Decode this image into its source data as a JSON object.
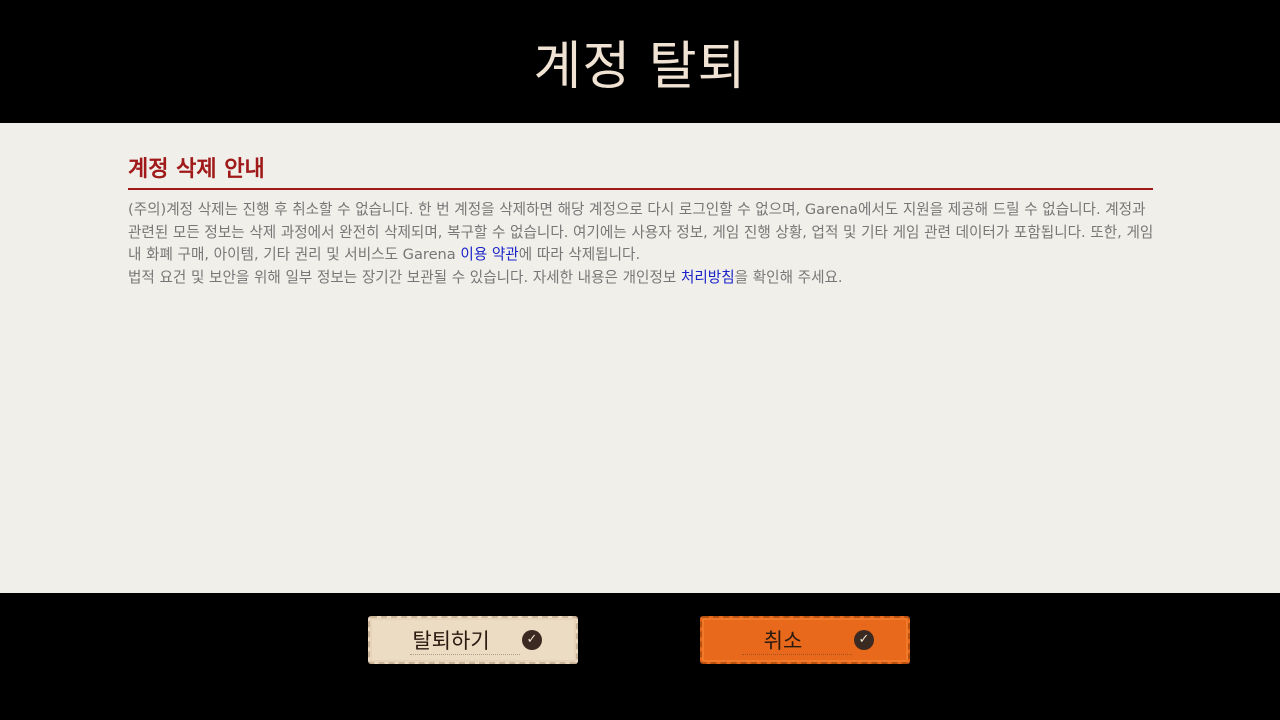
{
  "header": {
    "title": "계정 탈퇴"
  },
  "notice": {
    "title": "계정 삭제 안내",
    "para1_a": "(주의)계정 삭제는 진행 후 취소할 수 없습니다. 한 번 계정을 삭제하면 해당 계정으로 다시 로그인할 수 없으며, Garena에서도 지원을 제공해 드릴 수 없습니다. 계정과 관련된 모든 정보는 삭제 과정에서 완전히 삭제되며, 복구할 수 없습니다. 여기에는 사용자 정보, 게임 진행 상황, 업적 및 기타 게임 관련 데이터가 포함됩니다. 또한, 게임 내 화폐 구매, 아이템, 기타 권리 및 서비스도 Garena ",
    "terms_link": "이용 약관",
    "para1_b": "에 따라 삭제됩니다.",
    "para2_a": "법적 요건 및 보안을 위해 일부 정보는 장기간 보관될 수 있습니다. 자세한 내용은 개인정보 ",
    "privacy_link": "처리방침",
    "para2_b": "을 확인해 주세요."
  },
  "buttons": {
    "withdraw_label": "탈퇴하기",
    "cancel_label": "취소"
  },
  "colors": {
    "accent": "#a01a1a",
    "link": "#1a22c8",
    "withdraw_bg": "#ecdcc4",
    "cancel_bg": "#e8681c"
  },
  "icons": {
    "check": "check-circle-icon"
  }
}
